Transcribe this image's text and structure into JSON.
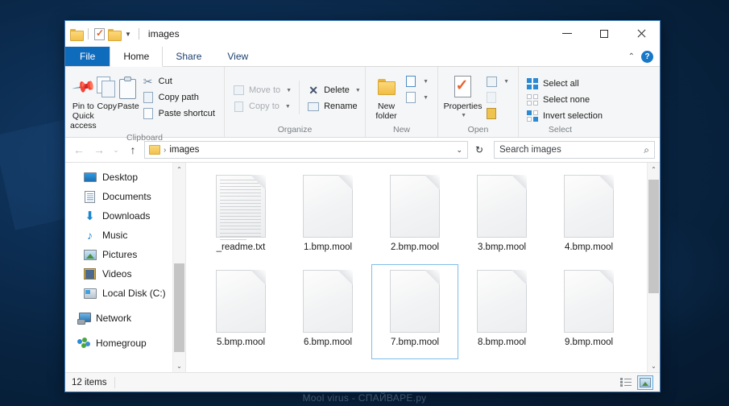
{
  "window": {
    "title": "images",
    "quick_access": [
      "folder-icon",
      "properties-icon",
      "new-folder-icon",
      "customize-caret"
    ],
    "controls": {
      "minimize": "Minimize",
      "maximize": "Maximize",
      "close": "Close"
    }
  },
  "tabs": [
    {
      "label": "File",
      "active": false,
      "kind": "file"
    },
    {
      "label": "Home",
      "active": true,
      "kind": "normal"
    },
    {
      "label": "Share",
      "active": false,
      "kind": "normal"
    },
    {
      "label": "View",
      "active": false,
      "kind": "normal"
    }
  ],
  "ribbon": {
    "collapse_label": "Collapse the Ribbon",
    "help_label": "?",
    "groups": [
      {
        "name": "Clipboard",
        "big_buttons": [
          {
            "label": "Pin to Quick access",
            "icon": "pin-icon",
            "enabled": true
          },
          {
            "label": "Copy",
            "icon": "copy-icon",
            "enabled": true
          },
          {
            "label": "Paste",
            "icon": "paste-icon",
            "enabled": true
          }
        ],
        "small_buttons": [
          {
            "label": "Cut",
            "icon": "scissors-icon",
            "enabled": true
          },
          {
            "label": "Copy path",
            "icon": "copy-path-icon",
            "enabled": true
          },
          {
            "label": "Paste shortcut",
            "icon": "paste-shortcut-icon",
            "enabled": true
          }
        ]
      },
      {
        "name": "Organize",
        "small_buttons_a": [
          {
            "label": "Move to",
            "icon": "move-to-icon",
            "enabled": false,
            "has_caret": true
          },
          {
            "label": "Copy to",
            "icon": "copy-to-icon",
            "enabled": false,
            "has_caret": true
          }
        ],
        "small_buttons_b": [
          {
            "label": "Delete",
            "icon": "delete-x-icon",
            "enabled": true,
            "has_caret": true
          },
          {
            "label": "Rename",
            "icon": "rename-icon",
            "enabled": true,
            "has_caret": false
          }
        ]
      },
      {
        "name": "New",
        "big_buttons": [
          {
            "label": "New folder",
            "icon": "new-folder-icon",
            "enabled": true
          }
        ],
        "small_buttons": [
          {
            "label": "",
            "icon": "new-item-icon",
            "enabled": true,
            "has_caret": true
          },
          {
            "label": "",
            "icon": "easy-access-icon",
            "enabled": true,
            "has_caret": true
          }
        ]
      },
      {
        "name": "Open",
        "big_buttons": [
          {
            "label": "Properties",
            "icon": "properties-icon",
            "enabled": true,
            "has_caret": true
          }
        ],
        "small_buttons": [
          {
            "label": "",
            "icon": "open-with-icon",
            "enabled": true,
            "has_caret": true
          },
          {
            "label": "",
            "icon": "edit-icon",
            "enabled": false,
            "has_caret": false
          },
          {
            "label": "",
            "icon": "history-icon",
            "enabled": true,
            "has_caret": false
          }
        ]
      },
      {
        "name": "Select",
        "small_buttons": [
          {
            "label": "Select all",
            "icon": "select-all-icon",
            "enabled": true
          },
          {
            "label": "Select none",
            "icon": "select-none-icon",
            "enabled": true
          },
          {
            "label": "Invert selection",
            "icon": "invert-selection-icon",
            "enabled": true
          }
        ]
      }
    ]
  },
  "address_bar": {
    "back": "Back",
    "forward": "Forward",
    "recent": "Recent locations",
    "up": "Up",
    "path_root_icon": "folder-icon",
    "path_text": "images",
    "dropdown": "Previous locations",
    "refresh": "Refresh",
    "search_placeholder": "Search images",
    "search_value": "",
    "search_icon": "search-icon"
  },
  "nav_pane": {
    "items": [
      {
        "label": "Desktop",
        "icon": "desktop-icon",
        "indent": true
      },
      {
        "label": "Documents",
        "icon": "documents-icon",
        "indent": true
      },
      {
        "label": "Downloads",
        "icon": "downloads-icon",
        "indent": true
      },
      {
        "label": "Music",
        "icon": "music-icon",
        "indent": true
      },
      {
        "label": "Pictures",
        "icon": "pictures-icon",
        "indent": true
      },
      {
        "label": "Videos",
        "icon": "videos-icon",
        "indent": true
      },
      {
        "label": "Local Disk (C:)",
        "icon": "local-disk-icon",
        "indent": true
      },
      {
        "label": "Network",
        "icon": "network-icon",
        "indent": false
      },
      {
        "label": "Homegroup",
        "icon": "homegroup-icon",
        "indent": false
      }
    ]
  },
  "files": [
    {
      "name": "_readme.txt",
      "icon": "text-file-icon",
      "selected": false
    },
    {
      "name": "1.bmp.mool",
      "icon": "blank-file-icon",
      "selected": false
    },
    {
      "name": "2.bmp.mool",
      "icon": "blank-file-icon",
      "selected": false
    },
    {
      "name": "3.bmp.mool",
      "icon": "blank-file-icon",
      "selected": false
    },
    {
      "name": "4.bmp.mool",
      "icon": "blank-file-icon",
      "selected": false
    },
    {
      "name": "5.bmp.mool",
      "icon": "blank-file-icon",
      "selected": false
    },
    {
      "name": "6.bmp.mool",
      "icon": "blank-file-icon",
      "selected": false
    },
    {
      "name": "7.bmp.mool",
      "icon": "blank-file-icon",
      "selected": true
    },
    {
      "name": "8.bmp.mool",
      "icon": "blank-file-icon",
      "selected": false
    },
    {
      "name": "9.bmp.mool",
      "icon": "blank-file-icon",
      "selected": false
    }
  ],
  "status_bar": {
    "item_count": "12 items",
    "view_details_label": "Details view",
    "view_thumbnails_label": "Large icons view",
    "active_view": "thumbnails"
  },
  "watermark": "Mool virus - СПАЙВАРЕ.ру",
  "colors": {
    "accent": "#0f6cbd",
    "window_border": "#3f7fbf",
    "selection_border": "#7fbde8",
    "folder_yellow": "#f2c14e",
    "help_blue": "#1878c8"
  }
}
